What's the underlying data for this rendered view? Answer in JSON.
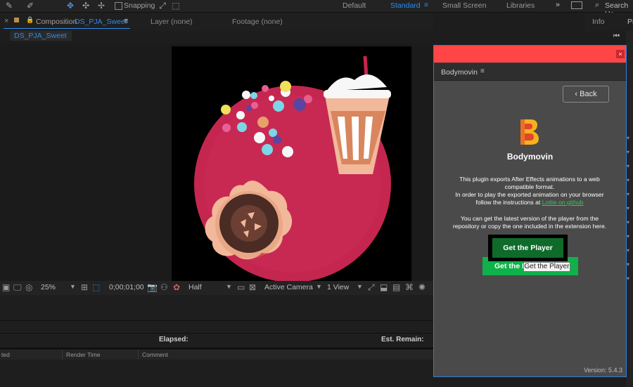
{
  "toolbar": {
    "snapping_label": "Snapping",
    "workspaces": [
      "Default",
      "Standard",
      "Small Screen",
      "Libraries"
    ],
    "active_workspace": "Standard",
    "search_label": "Search He"
  },
  "composition_panel": {
    "tab_prefix": "Composition",
    "comp_name": "DS_PJA_Sweet",
    "layer_tab": "Layer (none)",
    "footage_tab": "Footage (none)",
    "selected_tab": "DS_PJA_Sweet"
  },
  "info_panel": {
    "tab_info": "Info",
    "tab_partial": "Pr"
  },
  "viewer_toolbar": {
    "zoom": "25%",
    "timecode": "0;00;01;00",
    "resolution": "Half",
    "camera": "Active Camera",
    "views": "1 View"
  },
  "render_queue": {
    "elapsed_label": "Elapsed:",
    "est_remain_label": "Est. Remain:",
    "col_status_partial": "ted",
    "col_render_time": "Render Time",
    "col_comment": "Comment"
  },
  "bodymovin": {
    "tab_label": "Bodymovin",
    "back_label": "‹ Back",
    "app_name": "Bodymovin",
    "desc_line1": "This plugin exports After Effects animations to a web",
    "desc_line2": "compatible format.",
    "desc_line3": "In order to play the exported animation on your browser",
    "desc_line4_prefix": "follow the instructions at",
    "desc_link": "Lottie on github",
    "desc_line5": "You can get the latest version of the player from the",
    "desc_line6": "repository or copy the one included in the extension here.",
    "get_player_label": "Get the Player",
    "get_player2_label": "Get the P",
    "tooltip": "Get the Player",
    "version": "Version: 5.4.3",
    "colors": {
      "title_bar": "#ff4545",
      "button_dark_green": "#0f6b2a",
      "button_green": "#0fb24a",
      "logo_yellow": "#f5b11e",
      "logo_red": "#e0462a"
    }
  }
}
